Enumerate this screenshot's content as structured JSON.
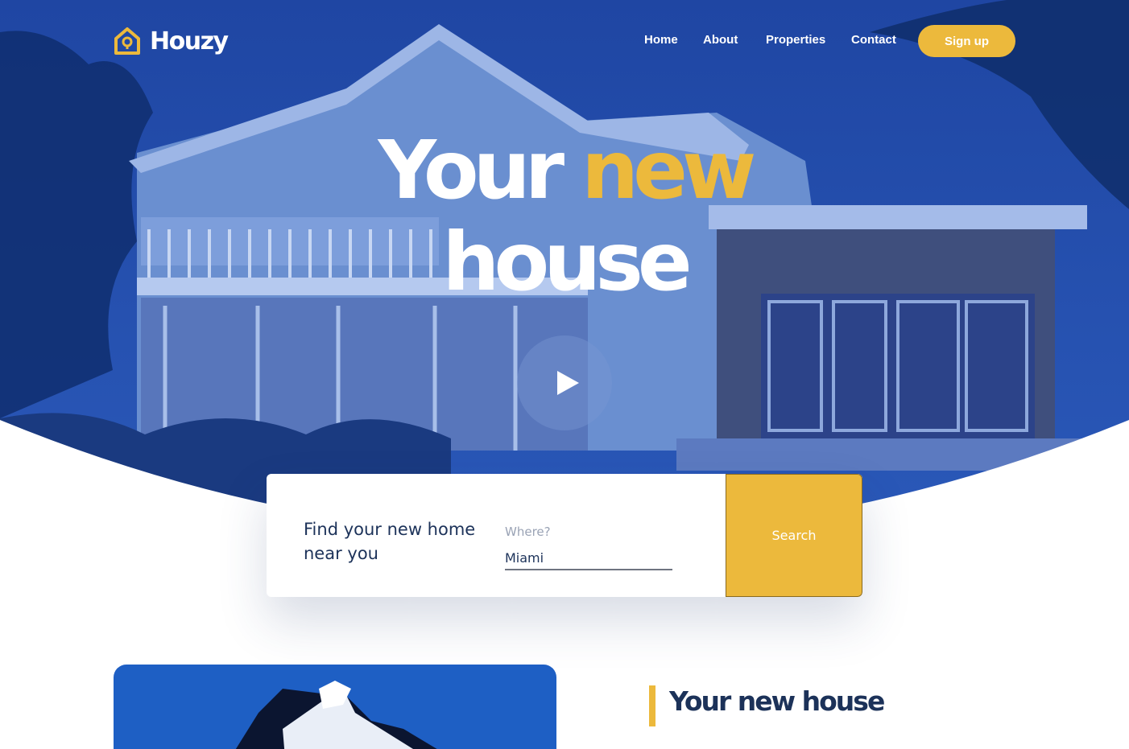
{
  "brand": {
    "name": "Houzy",
    "accent": "#ecb93c",
    "navy": "#1c3259"
  },
  "nav": {
    "items": [
      {
        "label": "Home"
      },
      {
        "label": "About"
      },
      {
        "label": "Properties"
      },
      {
        "label": "Contact"
      }
    ],
    "signup_label": "Sign up"
  },
  "hero": {
    "word1": "Your",
    "word2": "new",
    "word3": "house",
    "play_icon": "play-icon"
  },
  "search": {
    "title": "Find your new home near you",
    "where_label": "Where?",
    "where_value": "Miami",
    "button_label": "Search"
  },
  "section": {
    "title": "Your new house"
  }
}
